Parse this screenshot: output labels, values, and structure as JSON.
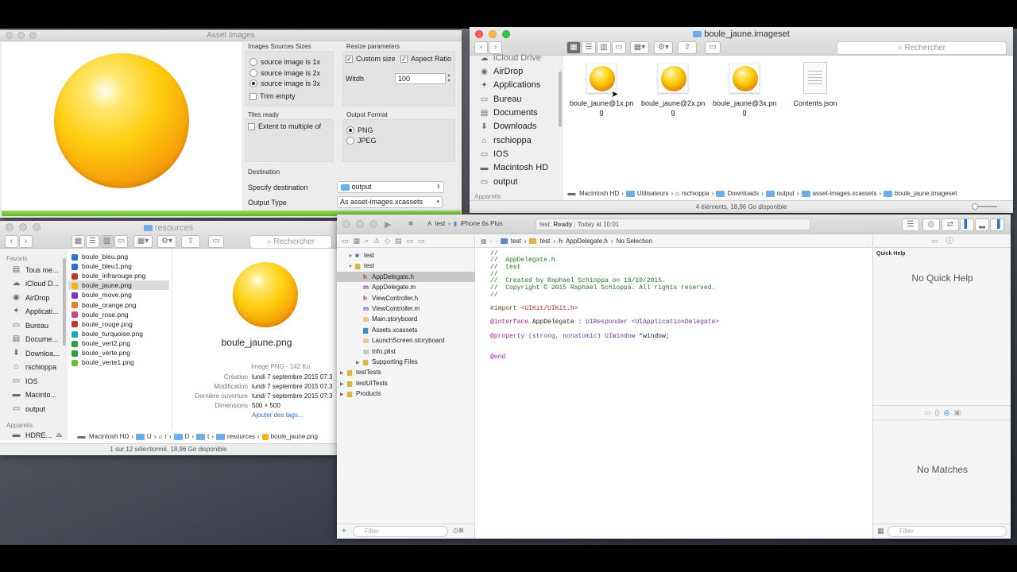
{
  "asset_window": {
    "title": "Asset Images",
    "sources_title": "Images Sources Sizes",
    "sources": [
      {
        "label": "source image is 1x",
        "selected": false
      },
      {
        "label": "source image is 2x",
        "selected": false
      },
      {
        "label": "source image is 3x",
        "selected": true
      }
    ],
    "trim_label": "Trim empty",
    "resize_title": "Resize parameters",
    "custom_size_label": "Custom size",
    "aspect_ratio_label": "Aspect Ratio",
    "width_label": "Witdh",
    "width_value": "100",
    "tiles_title": "Tiles ready",
    "extent_label": "Extent to multiple of",
    "output_format_title": "Output Format",
    "formats": [
      {
        "label": "PNG",
        "selected": true
      },
      {
        "label": "JPEG",
        "selected": false
      }
    ],
    "destination_title": "Destination",
    "specify_label": "Specify destination",
    "specify_value": "output",
    "output_type_label": "Output Type",
    "output_type_value": "As asset-images.xcassets"
  },
  "finder_top": {
    "title": "boule_jaune.imageset",
    "search_placeholder": "Rechercher",
    "sidebar": [
      "iCloud Drive",
      "AirDrop",
      "Applications",
      "Bureau",
      "Documents",
      "Downloads",
      "rschioppa",
      "IOS",
      "Macintosh HD",
      "output"
    ],
    "sidebar_section": "Appareils",
    "files": [
      {
        "line1": "boule_jaune@1x.pn",
        "line2": "g"
      },
      {
        "line1": "boule_jaune@2x.pn",
        "line2": "g"
      },
      {
        "line1": "boule_jaune@3x.pn",
        "line2": "g"
      },
      {
        "line1": "Contents.json",
        "line2": ""
      }
    ],
    "path": [
      "Macintosh HD",
      "Utilisateurs",
      "rschioppa",
      "Downloads",
      "output",
      "asset-images.xcassets",
      "boule_jaune.imageset"
    ],
    "status": "4 éléments, 18,96 Go disponible"
  },
  "finder_bottom": {
    "title": "resources",
    "search_placeholder": "Rechercher",
    "favorites_title": "Favoris",
    "sidebar": [
      "Tous me...",
      "iCloud D...",
      "AirDrop",
      "Applicati...",
      "Bureau",
      "Docume...",
      "Downloa...",
      "rschioppa",
      "IOS",
      "Macinto...",
      "output"
    ],
    "devices_title": "Appareils",
    "device": "HDRE...",
    "files": [
      {
        "name": "boule_bleu.png",
        "color": "#2f6fd6"
      },
      {
        "name": "boule_bleu1.png",
        "color": "#2f6fd6"
      },
      {
        "name": "boule_infrarouge.png",
        "color": "#c0392b"
      },
      {
        "name": "boule_jaune.png",
        "color": "#f2b40c"
      },
      {
        "name": "boule_move.png",
        "color": "#7d3bb8"
      },
      {
        "name": "boule_orange.png",
        "color": "#e67e22"
      },
      {
        "name": "boule_rose.png",
        "color": "#d0427f"
      },
      {
        "name": "boule_rouge.png",
        "color": "#c0392b"
      },
      {
        "name": "boule_turquoise.png",
        "color": "#1aa6b7"
      },
      {
        "name": "boule_vert2.png",
        "color": "#2e9e3e"
      },
      {
        "name": "boule_verte.png",
        "color": "#2e9e3e"
      },
      {
        "name": "boule_verte1.png",
        "color": "#6cbf2e"
      }
    ],
    "selected_index": 3,
    "preview_name": "boule_jaune.png",
    "kind": "Image PNG - 142 Ko",
    "info": [
      {
        "label": "Création",
        "value": "lundi 7 septembre 2015 07:3"
      },
      {
        "label": "Modification",
        "value": "lundi 7 septembre 2015 07:3"
      },
      {
        "label": "Dernière ouverture",
        "value": "lundi 7 septembre 2015 07:3"
      },
      {
        "label": "Dimensions",
        "value": "500 × 500"
      }
    ],
    "add_tags": "Ajouter des tags...",
    "path": [
      "Macintosh HD",
      "U",
      "r",
      "D",
      "t",
      "resources",
      "boule_jaune.png"
    ],
    "status": "1 sur 12 sélectionné, 18,96 Go disponible"
  },
  "xcode": {
    "scheme": "test",
    "device": "iPhone 6s Plus",
    "status_prefix": "test:",
    "status_state": "Ready",
    "status_time": "Today at 10:01",
    "jump_bar": [
      "test",
      "test",
      "AppDelegate.h",
      "No Selection"
    ],
    "navigator": [
      {
        "name": "test",
        "icon": "proj",
        "selected": false,
        "disclosure": "▼"
      },
      {
        "name": "test",
        "icon": "folder",
        "selected": false,
        "disclosure": "▼"
      },
      {
        "name": "AppDelegate.h",
        "icon": "h",
        "selected": true,
        "disclosure": ""
      },
      {
        "name": "AppDelegate.m",
        "icon": "m",
        "selected": false,
        "disclosure": ""
      },
      {
        "name": "ViewController.h",
        "icon": "h",
        "selected": false,
        "disclosure": ""
      },
      {
        "name": "ViewController.m",
        "icon": "m",
        "selected": false,
        "disclosure": ""
      },
      {
        "name": "Main.storyboard",
        "icon": "sb",
        "selected": false,
        "disclosure": ""
      },
      {
        "name": "Assets.xcassets",
        "icon": "xc",
        "selected": false,
        "disclosure": ""
      },
      {
        "name": "LaunchScreen.storyboard",
        "icon": "sb",
        "selected": false,
        "disclosure": ""
      },
      {
        "name": "Info.plist",
        "icon": "pl",
        "selected": false,
        "disclosure": ""
      },
      {
        "name": "Supporting Files",
        "icon": "folder",
        "selected": false,
        "disclosure": "▶"
      },
      {
        "name": "testTests",
        "icon": "folder",
        "selected": false,
        "disclosure": "▶"
      },
      {
        "name": "testUITests",
        "icon": "folder",
        "selected": false,
        "disclosure": "▶"
      },
      {
        "name": "Products",
        "icon": "folder",
        "selected": false,
        "disclosure": "▶"
      }
    ],
    "filter_placeholder": "Filter",
    "code": {
      "c1": "//",
      "c2": "//  AppDelegate.h",
      "c3": "//  test",
      "c4": "//",
      "c5": "//  Created by Raphael Schioppa on 10/10/2015.",
      "c6": "//  Copyright © 2015 Raphael Schioppa. All rights reserved.",
      "c7": "//",
      "import_kw": "#import",
      "import_path": "<UIKit/UIKit.h>",
      "interface_kw": "@interface",
      "interface_name": "AppDelegate :",
      "interface_super": "UIResponder",
      "interface_protocol": "<UIApplicationDelegate>",
      "property_kw": "@property",
      "property_attrs": "(strong, nonatomic)",
      "property_type": "UIWindow",
      "property_var": "*window;",
      "end_kw": "@end"
    },
    "quick_help_title": "Quick Help",
    "no_quick_help": "No Quick Help",
    "no_matches": "No Matches"
  }
}
